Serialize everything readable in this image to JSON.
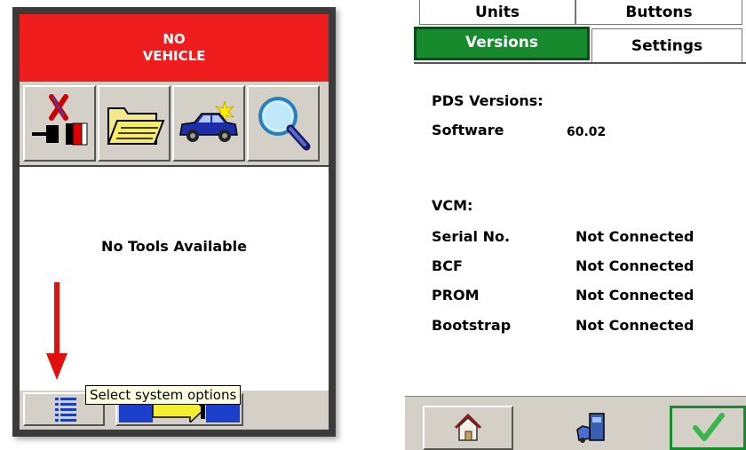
{
  "left_screen": {
    "banner": {
      "line1": "NO",
      "line2": "VEHICLE",
      "color": "#ee1c1c"
    },
    "toolbar": [
      {
        "icon": "disconnected-plug-icon"
      },
      {
        "icon": "open-folder-icon"
      },
      {
        "icon": "new-vehicle-car-icon"
      },
      {
        "icon": "magnifier-icon"
      }
    ],
    "tools_message": "No Tools Available",
    "tooltip": "Select system options",
    "bottom_buttons": [
      {
        "icon": "system-options-list-icon"
      },
      {
        "icon": "export-arrow-icon"
      }
    ]
  },
  "right_screen": {
    "tabs": {
      "units": "Units",
      "buttons": "Buttons",
      "versions": "Versions",
      "settings": "Settings"
    },
    "active_tab": "Versions",
    "active_tab_color": "#168a2c",
    "pds_heading": "PDS Versions:",
    "software_label": "Software",
    "software_value": "60.02",
    "vcm_heading": "VCM:",
    "vcm_rows": [
      {
        "label": "Serial No.",
        "value": "Not Connected"
      },
      {
        "label": "BCF",
        "value": "Not Connected"
      },
      {
        "label": "PROM",
        "value": "Not Connected"
      },
      {
        "label": "Bootstrap",
        "value": "Not Connected"
      }
    ],
    "footer_buttons": [
      {
        "icon": "home-icon"
      },
      {
        "icon": "vcm-device-icon"
      },
      {
        "icon": "checkmark-icon"
      }
    ]
  }
}
